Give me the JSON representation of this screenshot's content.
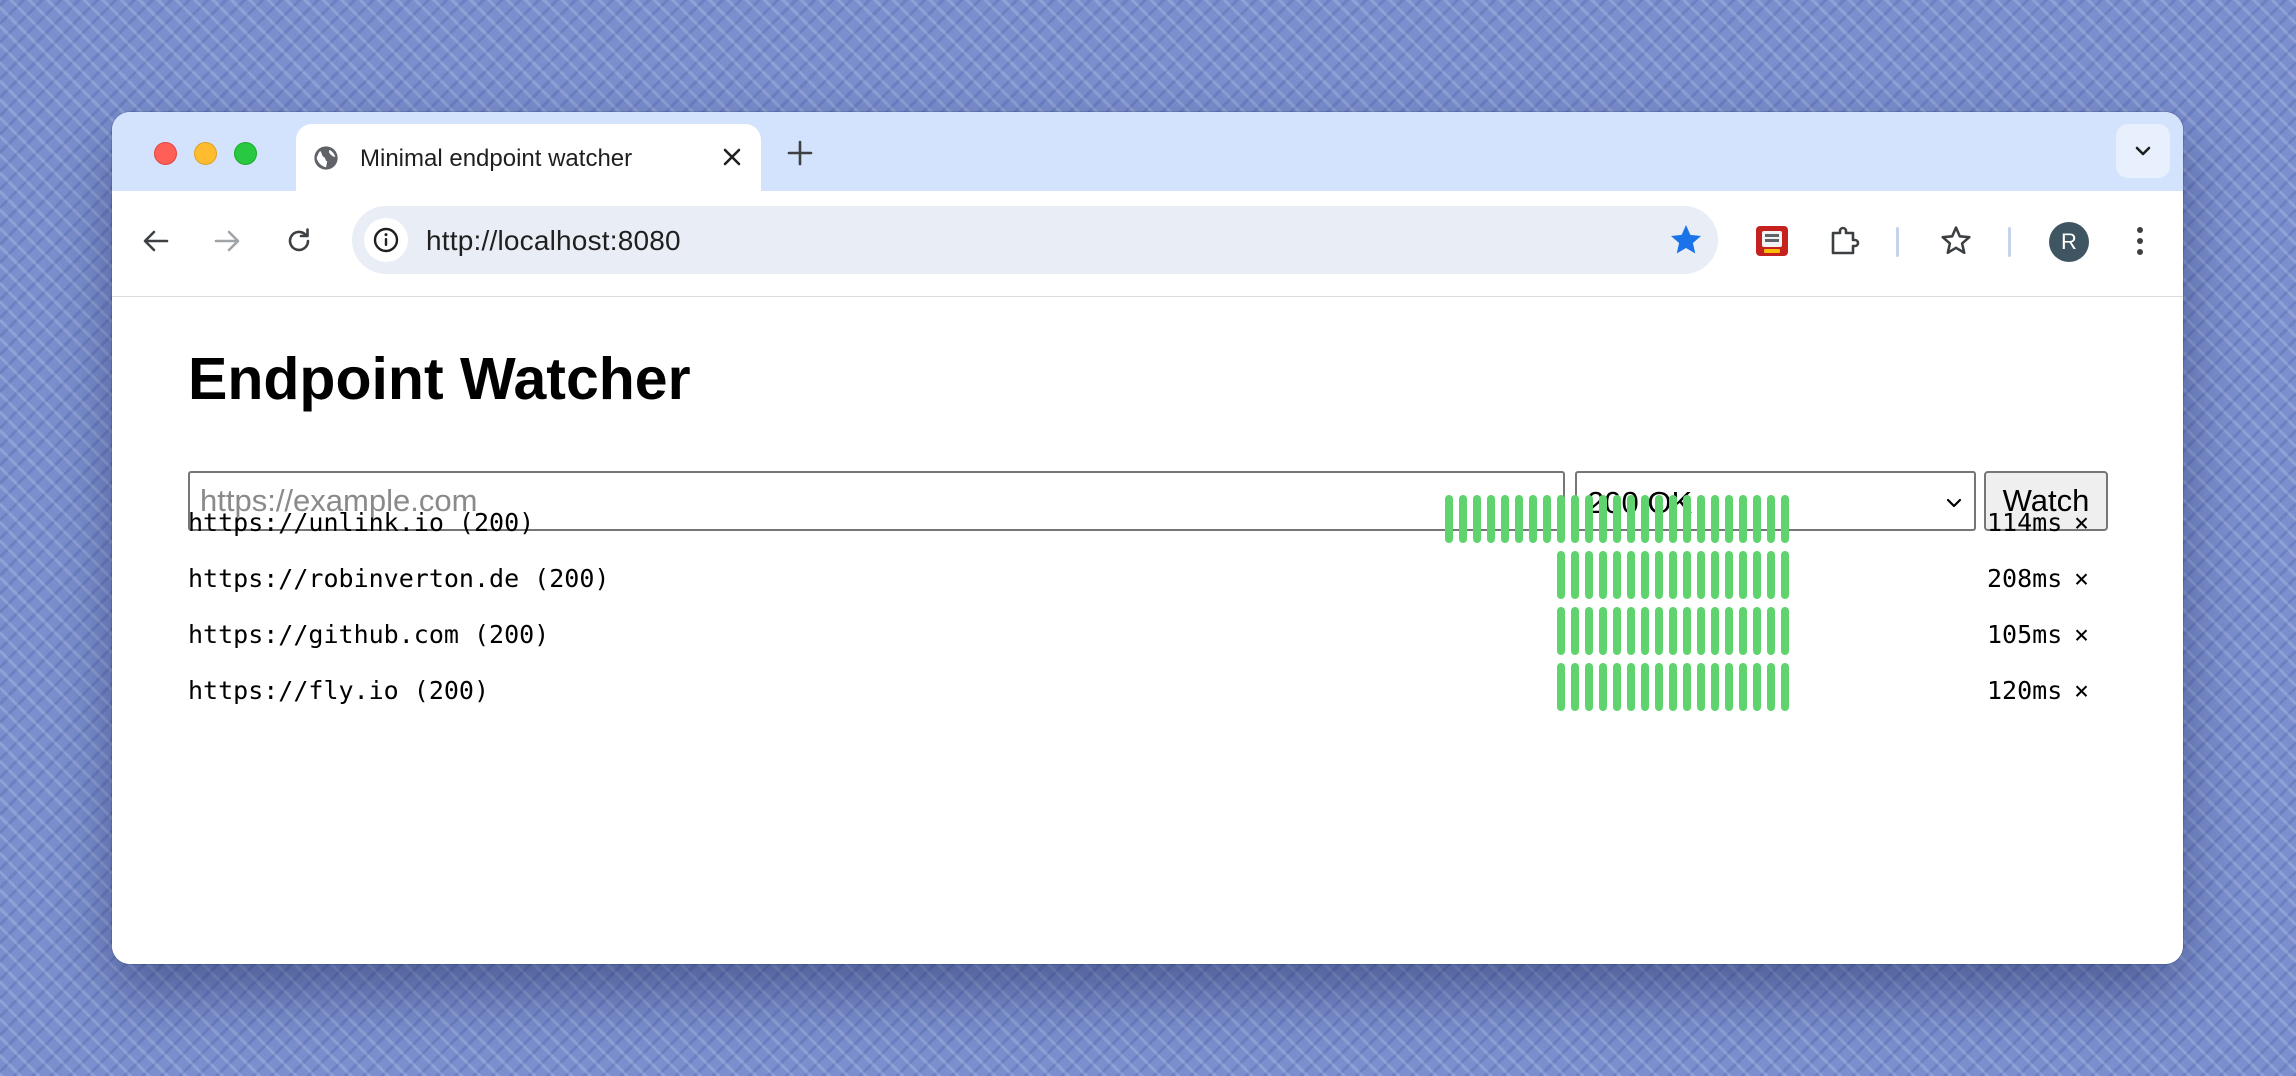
{
  "browser": {
    "tab_title": "Minimal endpoint watcher",
    "address": "http://localhost:8080",
    "avatar_initial": "R",
    "accent_color": "#1a73e8"
  },
  "page": {
    "title": "Endpoint Watcher",
    "url_placeholder": "https://example.com",
    "url_value": "",
    "status_selected": "200 OK",
    "watch_label": "Watch",
    "bar_color": "#5fd46e",
    "endpoints": [
      {
        "label": "https://unlink.io (200)",
        "time": "114ms",
        "remove": "×",
        "checks": 25
      },
      {
        "label": "https://robinverton.de (200)",
        "time": "208ms",
        "remove": "×",
        "checks": 17
      },
      {
        "label": "https://github.com (200)",
        "time": "105ms",
        "remove": "×",
        "checks": 17
      },
      {
        "label": "https://fly.io (200)",
        "time": "120ms",
        "remove": "×",
        "checks": 17
      }
    ]
  }
}
